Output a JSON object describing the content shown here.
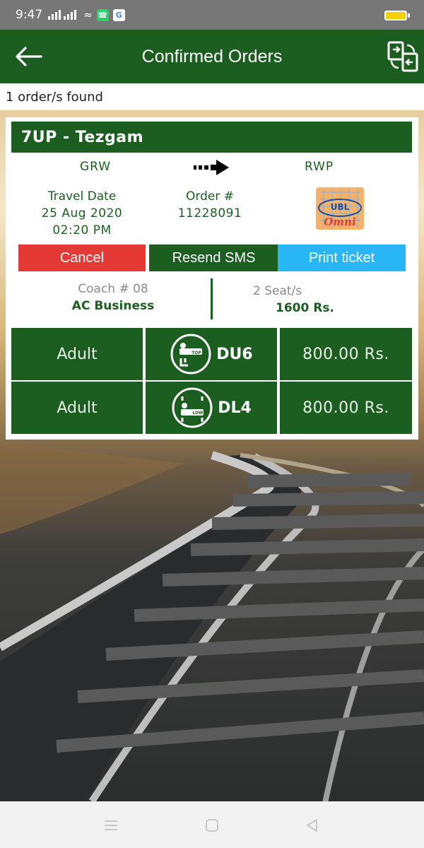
{
  "status_bar": {
    "time": "9:47",
    "icons": [
      "signal-icon",
      "signal-icon",
      "wifi-icon",
      "whatsapp-icon",
      "google-icon",
      "battery-icon"
    ]
  },
  "app_bar": {
    "title": "Confirmed Orders",
    "back_icon": "arrow-left-icon",
    "action_icon": "swap-orders-icon",
    "color": "#1b5e20"
  },
  "orders_found": "1 order/s found",
  "order": {
    "train": "7UP - Tezgam",
    "from": "GRW",
    "to": "RWP",
    "travel_date_label": "Travel Date",
    "travel_date": "25 Aug 2020",
    "travel_time": "02:20 PM",
    "order_label": "Order #",
    "order_number": "11228091",
    "payment_logo": {
      "line1": "UBL",
      "line2": "Omni"
    },
    "buttons": {
      "cancel": "Cancel",
      "resend": "Resend SMS",
      "print": "Print ticket"
    },
    "coach": "Coach # 08",
    "coach_class": "AC Business",
    "seats": "2 Seat/s",
    "total_fare": "1600 Rs.",
    "passengers": [
      {
        "type": "Adult",
        "berth_icon": "upper-berth-icon",
        "berth_icon_text": "TOP",
        "seat": "DU6",
        "price": "800.00 Rs."
      },
      {
        "type": "Adult",
        "berth_icon": "lower-berth-icon",
        "berth_icon_text": "LOW",
        "seat": "DL4",
        "price": "800.00 Rs."
      }
    ]
  },
  "colors": {
    "primary": "#1b5e20",
    "cancel": "#e53935",
    "print": "#29b6f6"
  },
  "nav_bar": {
    "icons": [
      "menu-icon",
      "home-icon",
      "back-icon"
    ]
  }
}
